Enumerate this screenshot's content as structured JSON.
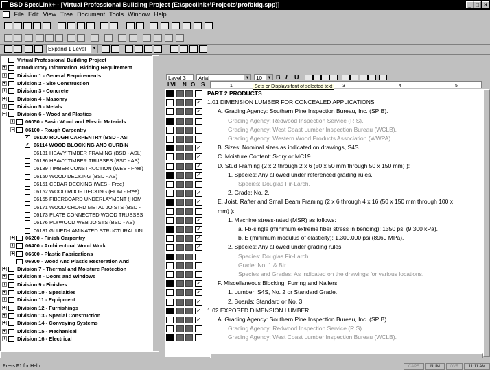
{
  "window": {
    "title": "BSD SpecLink+ - [Virtual Professional Building Project (E:\\speclink+\\Projects\\profbldg.spp)]"
  },
  "menu": [
    "File",
    "Edit",
    "View",
    "Tree",
    "Document",
    "Tools",
    "Window",
    "Help"
  ],
  "tree_toolbar": {
    "expand_label": "Expand 1 Level"
  },
  "format_bar": {
    "level": "Level 3",
    "font": "Arial",
    "size": "10",
    "tooltip": "Sets or Displays font of selected text"
  },
  "columns": {
    "lvl": "LVL",
    "n": "N",
    "o": "O",
    "s": "S"
  },
  "ruler": [
    "1",
    "2",
    "3",
    "4",
    "5"
  ],
  "tree": [
    {
      "label": "Virtual Professional Building Project",
      "bold": true,
      "depth": 0,
      "kind": "root"
    },
    {
      "label": "Introductory Information, Bidding Requirement",
      "bold": true,
      "depth": 0,
      "kind": "div"
    },
    {
      "label": "Division 1 - General Requirements",
      "bold": true,
      "depth": 0,
      "kind": "div"
    },
    {
      "label": "Division 2 - Site Construction",
      "bold": true,
      "depth": 0,
      "kind": "div"
    },
    {
      "label": "Division 3 - Concrete",
      "bold": true,
      "depth": 0,
      "kind": "div"
    },
    {
      "label": "Division 4 - Masonry",
      "bold": true,
      "depth": 0,
      "kind": "div"
    },
    {
      "label": "Division 5 - Metals",
      "bold": true,
      "depth": 0,
      "kind": "div"
    },
    {
      "label": "Division 6 - Wood and Plastics",
      "bold": true,
      "depth": 0,
      "kind": "divopen"
    },
    {
      "label": "06050 - Basic Wood and Plastic Materials",
      "bold": true,
      "depth": 1,
      "kind": "folder"
    },
    {
      "label": "06100 - Rough Carpentry",
      "bold": true,
      "depth": 1,
      "kind": "folderopen"
    },
    {
      "label": "06100  ROUGH CARPENTRY (BSD - ASI",
      "bold": true,
      "depth": 2,
      "kind": "checked"
    },
    {
      "label": "06114  WOOD BLOCKING AND CURBIN",
      "bold": true,
      "depth": 2,
      "kind": "checked"
    },
    {
      "label": "06131  HEAVY TIMBER FRAMING (BSD - ASL)",
      "bold": false,
      "depth": 2,
      "kind": "box"
    },
    {
      "label": "06136  HEAVY TIMBER TRUSSES (BSD - AS)",
      "bold": false,
      "depth": 2,
      "kind": "box"
    },
    {
      "label": "06139  TIMBER CONSTRUCTION (WES - Free)",
      "bold": false,
      "depth": 2,
      "kind": "box"
    },
    {
      "label": "06150  WOOD DECKING (BSD - AS)",
      "bold": false,
      "depth": 2,
      "kind": "box"
    },
    {
      "label": "06151  CEDAR DECKING (WES - Free)",
      "bold": false,
      "depth": 2,
      "kind": "box"
    },
    {
      "label": "06152  WOOD ROOF DECKING (HOM - Free)",
      "bold": false,
      "depth": 2,
      "kind": "box"
    },
    {
      "label": "06165  FIBERBOARD UNDERLAYMENT (HOM",
      "bold": false,
      "depth": 2,
      "kind": "box"
    },
    {
      "label": "06171  WOOD CHORD METAL JOISTS (BSD -",
      "bold": false,
      "depth": 2,
      "kind": "box"
    },
    {
      "label": "06173  PLATE CONNECTED WOOD TRUSSES",
      "bold": false,
      "depth": 2,
      "kind": "box"
    },
    {
      "label": "06176  PLYWOOD WEB JOISTS (BSD - AS)",
      "bold": false,
      "depth": 2,
      "kind": "box"
    },
    {
      "label": "06181  GLUED-LAMINATED STRUCTURAL UN",
      "bold": false,
      "depth": 2,
      "kind": "box"
    },
    {
      "label": "06200 - Finish Carpentry",
      "bold": true,
      "depth": 1,
      "kind": "folder"
    },
    {
      "label": "06400 - Architectural Wood Work",
      "bold": true,
      "depth": 1,
      "kind": "folder"
    },
    {
      "label": "06600 - Plastic Fabrications",
      "bold": true,
      "depth": 1,
      "kind": "folder"
    },
    {
      "label": "06900 - Wood And Plastic Restoration And",
      "bold": true,
      "depth": 1,
      "kind": "foldernoexp"
    },
    {
      "label": "Division 7 - Thermal and Moisture Protection",
      "bold": true,
      "depth": 0,
      "kind": "div"
    },
    {
      "label": "Division 8 - Doors and Windows",
      "bold": true,
      "depth": 0,
      "kind": "div"
    },
    {
      "label": "Division 9 - Finishes",
      "bold": true,
      "depth": 0,
      "kind": "div"
    },
    {
      "label": "Division 10 - Specialties",
      "bold": true,
      "depth": 0,
      "kind": "div"
    },
    {
      "label": "Division 11 - Equipment",
      "bold": true,
      "depth": 0,
      "kind": "div"
    },
    {
      "label": "Division 12 - Furnishings",
      "bold": true,
      "depth": 0,
      "kind": "div"
    },
    {
      "label": "Division 13 - Special Construction",
      "bold": true,
      "depth": 0,
      "kind": "div"
    },
    {
      "label": "Division 14 - Conveying Systems",
      "bold": true,
      "depth": 0,
      "kind": "div"
    },
    {
      "label": "Division 15 - Mechanical",
      "bold": true,
      "depth": 0,
      "kind": "div"
    },
    {
      "label": "Division 16 - Electrical",
      "bold": true,
      "depth": 0,
      "kind": "div"
    }
  ],
  "doc": [
    {
      "t": "PART 2  PRODUCTS",
      "ind": 0,
      "g": false,
      "chk": false
    },
    {
      "t": "1.01 DIMENSION LUMBER FOR CONCEALED APPLICATIONS",
      "ind": 0,
      "g": false,
      "chk": true
    },
    {
      "t": "A.   Grading Agency:  Southern Pine Inspection Bureau, Inc. (SPIB).",
      "ind": 1,
      "g": false,
      "chk": true
    },
    {
      "t": "Grading Agency:  Redwood Inspection Service (RIS).",
      "ind": 2,
      "g": true,
      "chk": false
    },
    {
      "t": "Grading Agency:  West Coast Lumber Inspection Bureau (WCLB).",
      "ind": 2,
      "g": true,
      "chk": false
    },
    {
      "t": "Grading Agency:  Western Wood Products Association (WWPA).",
      "ind": 2,
      "g": true,
      "chk": false
    },
    {
      "t": "B.   Sizes:  Nominal sizes as indicated on drawings, S4S.",
      "ind": 1,
      "g": false,
      "chk": true
    },
    {
      "t": "C.   Moisture Content:  S-dry or MC19.",
      "ind": 1,
      "g": false,
      "chk": true
    },
    {
      "t": "D.   Stud Framing (2 x 2 through 2 x 6 (50 x 50 mm through 50 x 150 mm) ):",
      "ind": 1,
      "g": false,
      "chk": true
    },
    {
      "t": "1.    Species:  Any allowed under referenced grading rules.",
      "ind": 2,
      "g": false,
      "chk": true
    },
    {
      "t": "Species:  Douglas Fir-Larch.",
      "ind": 3,
      "g": true,
      "chk": false
    },
    {
      "t": "2.    Grade:  No. 2.",
      "ind": 2,
      "g": false,
      "chk": true
    },
    {
      "t": "E.   Joist, Rafter and Small Beam Framing (2 x 6 through 4 x 16 (50 x 150 mm through 100 x",
      "ind": 1,
      "g": false,
      "chk": true
    },
    {
      "t": "mm) ):",
      "ind": 1,
      "g": false,
      "chk": false,
      "cont": true
    },
    {
      "t": "1.    Machine stress-rated (MSR) as follows:",
      "ind": 2,
      "g": false,
      "chk": true
    },
    {
      "t": "a.    Fb-single (minimum extreme fiber stress in bending):  1350 psi (9,300 kPa).",
      "ind": 3,
      "g": false,
      "chk": true
    },
    {
      "t": "b.    E (minimum modulus of elasticity):  1,300,000 psi (8960 MPa).",
      "ind": 3,
      "g": false,
      "chk": true
    },
    {
      "t": "2.    Species:  Any allowed under grading rules.",
      "ind": 2,
      "g": false,
      "chk": true
    },
    {
      "t": "Species:  Douglas Fir-Larch.",
      "ind": 3,
      "g": true,
      "chk": false
    },
    {
      "t": "Grade:  No. 1 & Btr.",
      "ind": 3,
      "g": true,
      "chk": false
    },
    {
      "t": "Species and Grades:  As indicated on the drawings for various locations.",
      "ind": 3,
      "g": true,
      "chk": false
    },
    {
      "t": "F.   Miscellaneous Blocking, Furring and Nailers:",
      "ind": 1,
      "g": false,
      "chk": true
    },
    {
      "t": "1.    Lumber:  S4S, No. 2 or Standard Grade.",
      "ind": 2,
      "g": false,
      "chk": true
    },
    {
      "t": "2.    Boards:  Standard or No. 3.",
      "ind": 2,
      "g": false,
      "chk": true
    },
    {
      "t": "1.02 EXPOSED DIMENSION LUMBER",
      "ind": 0,
      "g": false,
      "chk": true
    },
    {
      "t": "A.   Grading Agency:  Southern Pine Inspection Bureau, Inc. (SPIB).",
      "ind": 1,
      "g": false,
      "chk": true
    },
    {
      "t": "Grading Agency:  Redwood Inspection Service (RIS).",
      "ind": 2,
      "g": true,
      "chk": false
    },
    {
      "t": "Grading Agency:  West Coast Lumber Inspection Bureau (WCLB).",
      "ind": 2,
      "g": true,
      "chk": false
    }
  ],
  "status": {
    "help": "Press F1 for Help",
    "caps": "CAPS",
    "num": "NUM",
    "ovr": "OVR",
    "time": "11:11 AM"
  }
}
